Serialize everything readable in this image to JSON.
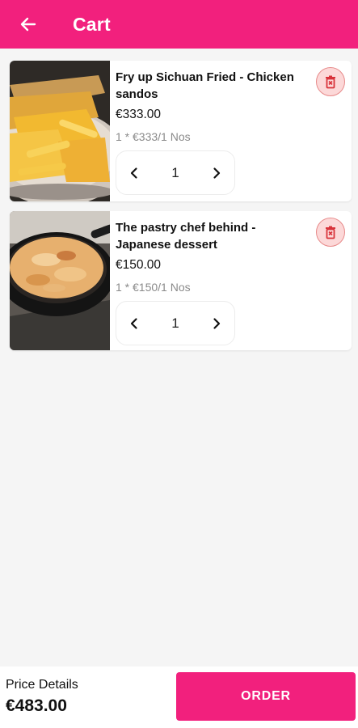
{
  "header": {
    "title": "Cart",
    "back_icon": "arrow-left-icon",
    "color": "#f2207d"
  },
  "cart": {
    "items": [
      {
        "name": "Fry up Sichuan Fried - Chicken sandos",
        "price": "€333.00",
        "unit_price": "1 * €333/1 Nos",
        "quantity": "1",
        "image": "fried-chicken-fries-photo"
      },
      {
        "name": "The pastry chef behind - Japanese dessert",
        "price": "€150.00",
        "unit_price": "1 * €150/1 Nos",
        "quantity": "1",
        "image": "baked-pasta-skillet-photo"
      }
    ]
  },
  "footer": {
    "price_label": "Price Details",
    "total": "€483.00",
    "order_label": "ORDER"
  },
  "colors": {
    "primary": "#f2207d",
    "delete_bg": "#fcd8d8",
    "delete_icon": "#d8323a"
  }
}
